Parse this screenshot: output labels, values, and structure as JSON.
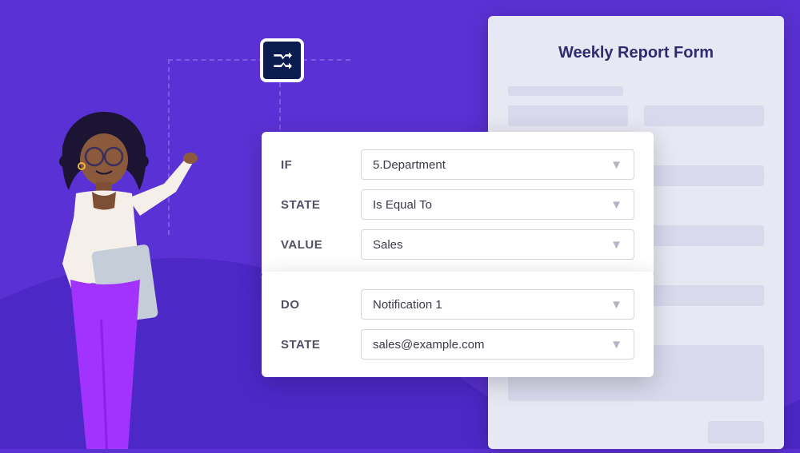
{
  "form": {
    "title": "Weekly Report Form"
  },
  "conditionIf": {
    "rows": [
      {
        "label": "IF",
        "value": "5.Department"
      },
      {
        "label": "STATE",
        "value": "Is Equal To"
      },
      {
        "label": "VALUE",
        "value": "Sales"
      }
    ]
  },
  "conditionDo": {
    "rows": [
      {
        "label": "DO",
        "value": "Notification 1"
      },
      {
        "label": "STATE",
        "value": "sales@example.com"
      }
    ]
  }
}
